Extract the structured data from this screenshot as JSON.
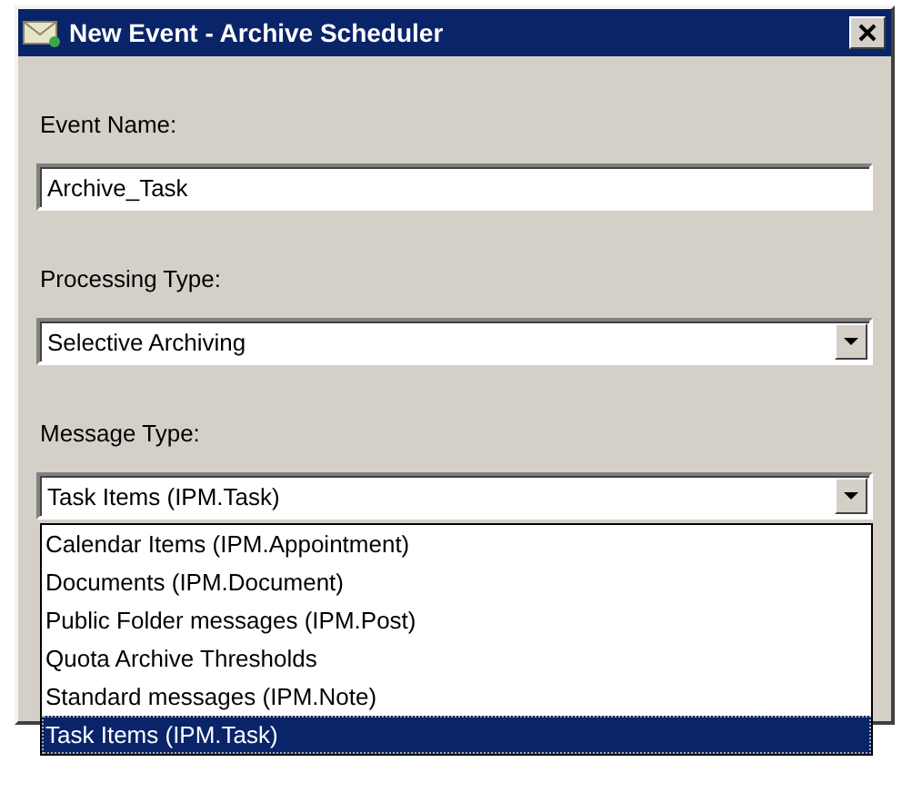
{
  "window": {
    "title": "New Event - Archive Scheduler"
  },
  "fields": [
    {
      "kind": "text",
      "label": "Event Name:",
      "value": "Archive_Task"
    },
    {
      "kind": "combo",
      "label": "Processing Type:",
      "value": "Selective Archiving"
    },
    {
      "kind": "combo",
      "label": "Message Type:",
      "value": "Task Items (IPM.Task)",
      "expanded": true,
      "options": [
        {
          "label": "Calendar Items (IPM.Appointment)",
          "selected": false
        },
        {
          "label": "Documents (IPM.Document)",
          "selected": false
        },
        {
          "label": "Public Folder messages (IPM.Post)",
          "selected": false
        },
        {
          "label": "Quota Archive Thresholds",
          "selected": false
        },
        {
          "label": "Standard messages (IPM.Note)",
          "selected": false
        },
        {
          "label": "Task Items (IPM.Task)",
          "selected": true
        }
      ]
    }
  ]
}
